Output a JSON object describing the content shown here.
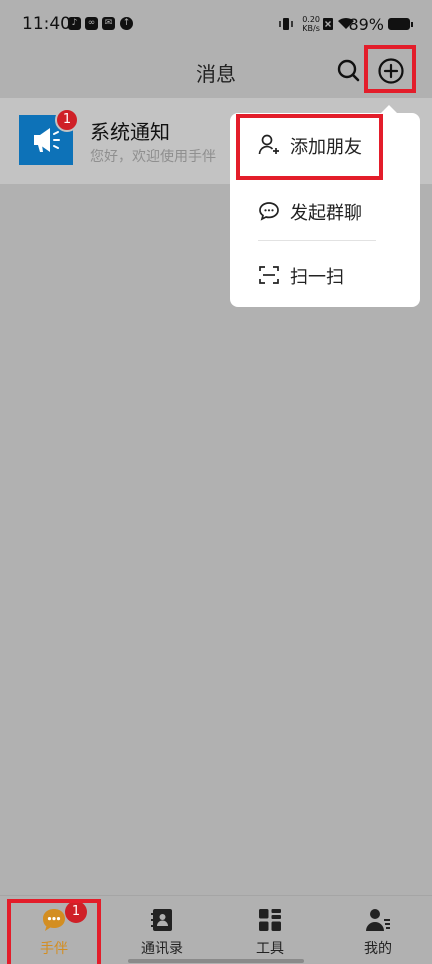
{
  "status_bar": {
    "time": "11:40",
    "net_speed_value": "0.20",
    "net_speed_unit": "KB/s",
    "battery": "89%",
    "icons": [
      "tiktok-icon",
      "app-icon",
      "mail-icon",
      "upload-icon",
      "vibrate-icon",
      "no-sim-icon",
      "wifi-icon",
      "battery-icon"
    ]
  },
  "header": {
    "title": "消息",
    "search_icon": "search-icon",
    "add_icon": "plus-circle-icon"
  },
  "conversations": [
    {
      "title": "系统通知",
      "preview": "您好，欢迎使用手伴",
      "badge": "1",
      "avatar_icon": "megaphone-icon"
    }
  ],
  "popup_menu": {
    "items": [
      {
        "label": "添加朋友",
        "icon": "add-user-icon"
      },
      {
        "label": "发起群聊",
        "icon": "chat-icon"
      },
      {
        "label": "扫一扫",
        "icon": "scan-icon"
      }
    ]
  },
  "tabbar": {
    "tabs": [
      {
        "label": "手伴",
        "icon": "chat-bubble-icon",
        "badge": "1",
        "active": true
      },
      {
        "label": "通讯录",
        "icon": "contacts-book-icon",
        "active": false
      },
      {
        "label": "工具",
        "icon": "grid-tools-icon",
        "active": false
      },
      {
        "label": "我的",
        "icon": "user-profile-icon",
        "active": false
      }
    ]
  },
  "colors": {
    "overlay_bg": "#b1b1b1",
    "highlight": "#e31d2a",
    "badge": "#cf2027",
    "active_tab": "#d38e22",
    "avatar_bg": "#0d72b8"
  }
}
